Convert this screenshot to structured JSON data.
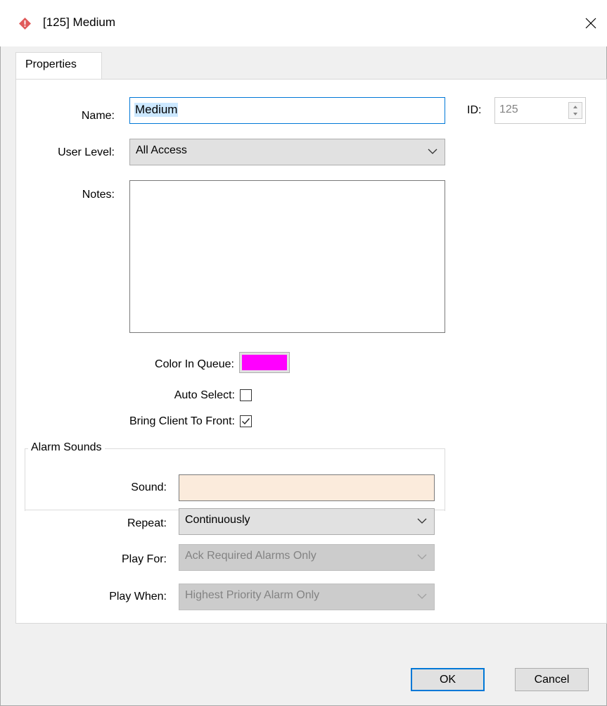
{
  "window": {
    "title": "[125] Medium",
    "icon": "red-diamond-icon",
    "close_icon": "close-icon"
  },
  "tabs": [
    {
      "label": "Properties",
      "active": true
    }
  ],
  "form": {
    "name_label": "Name:",
    "name_value": "Medium",
    "id_label": "ID:",
    "id_value": "125",
    "user_level_label": "User Level:",
    "user_level_value": "All Access",
    "notes_label": "Notes:",
    "notes_value": "",
    "color_in_queue_label": "Color In Queue:",
    "color_in_queue_value": "#ff00ff",
    "auto_select_label": "Auto Select:",
    "auto_select_checked": false,
    "bring_client_label": "Bring Client To Front:",
    "bring_client_checked": true
  },
  "alarm_sounds": {
    "legend": "Alarm Sounds",
    "sound_label": "Sound:",
    "sound_value": "",
    "sound_bg": "#fbebdc",
    "repeat_label": "Repeat:",
    "repeat_value": "Continuously",
    "play_for_label": "Play For:",
    "play_for_value": "Ack Required Alarms Only",
    "play_when_label": "Play When:",
    "play_when_value": "Highest Priority Alarm Only"
  },
  "buttons": {
    "ok": "OK",
    "cancel": "Cancel"
  },
  "colors": {
    "accent": "#0078d7",
    "selection": "#cce8ff"
  }
}
